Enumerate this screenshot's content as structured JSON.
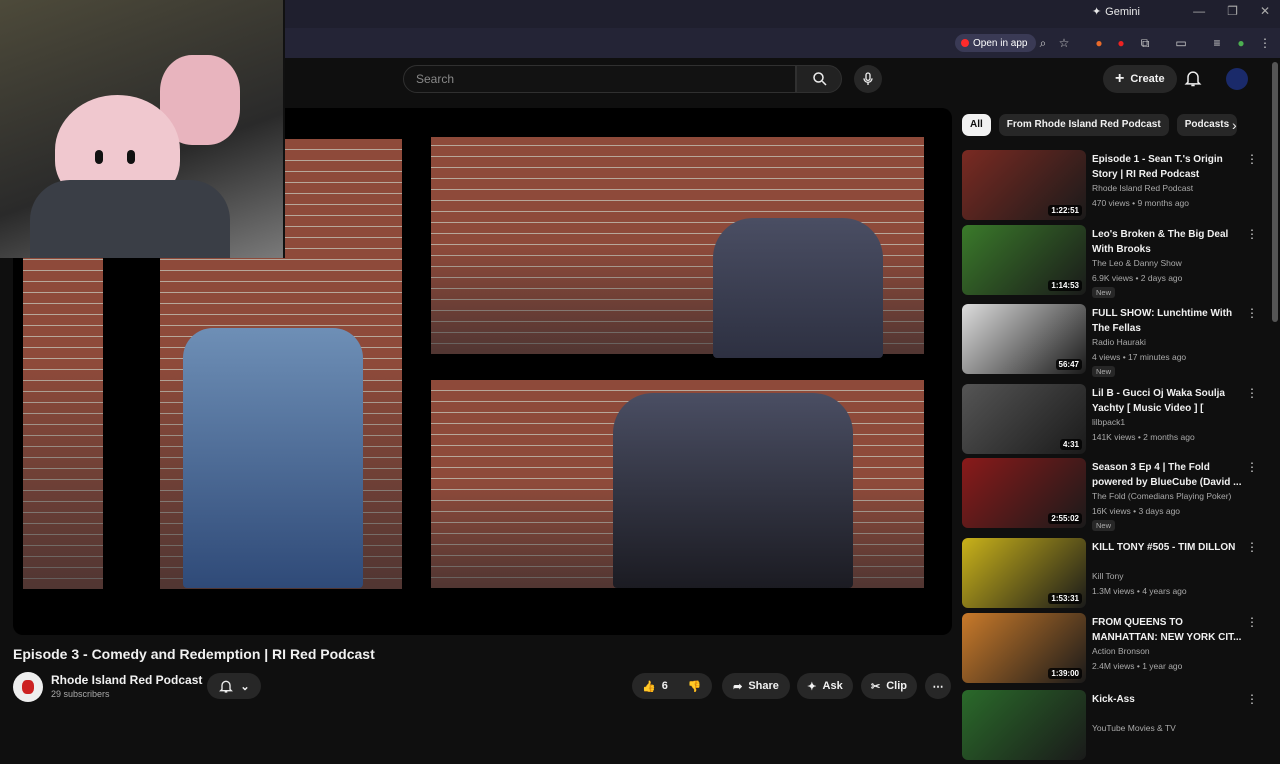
{
  "browser": {
    "gemini_label": "Gemini",
    "open_in_app": "Open in app"
  },
  "header": {
    "search_placeholder": "Search",
    "create_label": "Create"
  },
  "video": {
    "title": "Episode 3 - Comedy and Redemption | RI Red Podcast",
    "channel": "Rhode Island Red Podcast",
    "subscribers": "29 subscribers",
    "likes": "6",
    "share_label": "Share",
    "ask_label": "Ask",
    "clip_label": "Clip"
  },
  "chips": [
    "All",
    "From Rhode Island Red Podcast",
    "Podcasts"
  ],
  "recommendations": [
    {
      "title": "Episode 1 - Sean T.'s Origin Story | RI Red Podcast",
      "channel": "Rhode Island Red Podcast",
      "meta": "470 views • 9 months ago",
      "duration": "1:22:51",
      "new": "",
      "color": "#7a2a22"
    },
    {
      "title": "Leo's Broken & The Big Deal With Brooks",
      "channel": "The Leo & Danny Show",
      "meta": "6.9K views • 2 days ago",
      "duration": "1:14:53",
      "new": "New",
      "color": "#3a7a2a"
    },
    {
      "title": "FULL SHOW: Lunchtime With The Fellas",
      "channel": "Radio Hauraki",
      "meta": "4 views • 17 minutes ago",
      "duration": "56:47",
      "new": "New",
      "color": "#dddddd"
    },
    {
      "title": "Lil B - Gucci Oj Waka Soulja Yachty [ Music Video ] [ Officia...",
      "channel": "lilbpack1",
      "meta": "141K views • 2 months ago",
      "duration": "4:31",
      "new": "",
      "color": "#555555"
    },
    {
      "title": "Season 3 Ep 4 | The Fold powered by BlueCube (David ...",
      "channel": "The Fold (Comedians Playing Poker)",
      "meta": "16K views • 3 days ago",
      "duration": "2:55:02",
      "new": "New",
      "color": "#8a1a1a"
    },
    {
      "title": "KILL TONY #505 - TIM DILLON",
      "channel": "Kill Tony",
      "meta": "1.3M views • 4 years ago",
      "duration": "1:53:31",
      "new": "",
      "color": "#c9b21a"
    },
    {
      "title": "FROM QUEENS TO MANHATTAN: NEW YORK CIT...",
      "channel": "Action Bronson",
      "meta": "2.4M views • 1 year ago",
      "duration": "1:39:00",
      "new": "",
      "color": "#c97a2a"
    },
    {
      "title": "Kick-Ass",
      "channel": "YouTube Movies & TV",
      "meta": "",
      "duration": "",
      "new": "",
      "color": "#2a6a2a"
    }
  ]
}
